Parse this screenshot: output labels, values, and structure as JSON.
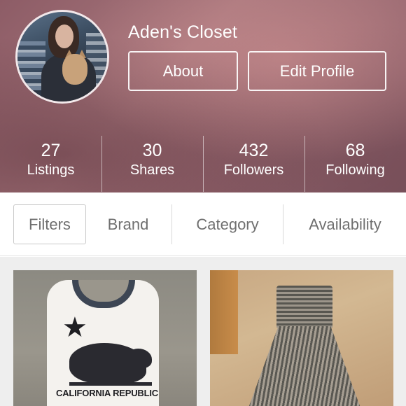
{
  "profile": {
    "closet_name": "Aden's Closet",
    "about_label": "About",
    "edit_profile_label": "Edit Profile"
  },
  "stats": [
    {
      "value": "27",
      "label": "Listings"
    },
    {
      "value": "30",
      "label": "Shares"
    },
    {
      "value": "432",
      "label": "Followers"
    },
    {
      "value": "68",
      "label": "Following"
    }
  ],
  "filters": {
    "filters_label": "Filters",
    "brand_label": "Brand",
    "category_label": "Category",
    "availability_label": "Availability"
  },
  "listings": [
    {
      "print_text": "CALIFORNIA REPUBLIC"
    },
    {
      "print_text": ""
    }
  ],
  "colors": {
    "header_tint": "#9a6a72",
    "text_on_header": "#ffffff",
    "filter_text": "#6f6f6f",
    "grid_bg": "#eeeeee"
  }
}
